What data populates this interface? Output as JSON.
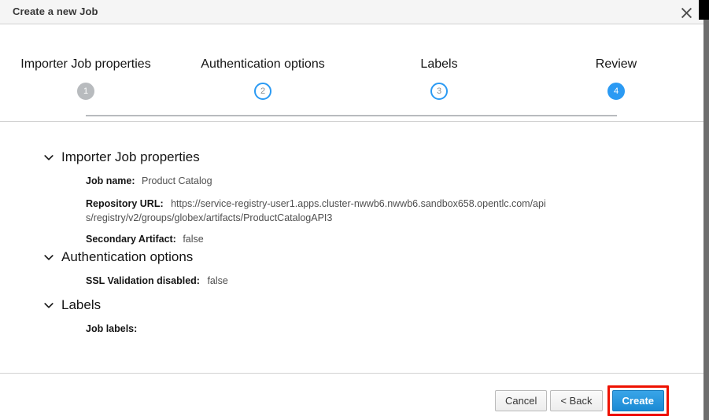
{
  "window": {
    "title": "Create a new Job",
    "close_icon": "close-icon"
  },
  "stepper": {
    "steps": [
      {
        "number": "1",
        "label": "Importer Job properties",
        "state": "done"
      },
      {
        "number": "2",
        "label": "Authentication options",
        "state": "pending"
      },
      {
        "number": "3",
        "label": "Labels",
        "state": "pending"
      },
      {
        "number": "4",
        "label": "Review",
        "state": "current"
      }
    ]
  },
  "review": {
    "sections": [
      {
        "title": "Importer Job properties",
        "chevron_icon": "chevron-down-icon",
        "expanded": true,
        "properties": [
          {
            "key": "Job name:",
            "value": "Product Catalog"
          },
          {
            "key": "Repository URL:",
            "value": "https://service-registry-user1.apps.cluster-nwwb6.nwwb6.sandbox658.opentlc.com/apis/registry/v2/groups/globex/artifacts/ProductCatalogAPI3"
          },
          {
            "key": "Secondary Artifact:",
            "value": "false"
          }
        ]
      },
      {
        "title": "Authentication options",
        "chevron_icon": "chevron-down-icon",
        "expanded": true,
        "properties": [
          {
            "key": "SSL Validation disabled:",
            "value": "false"
          }
        ]
      },
      {
        "title": "Labels",
        "chevron_icon": "chevron-down-icon",
        "expanded": true,
        "properties": [
          {
            "key": "Job labels:",
            "value": ""
          }
        ]
      }
    ]
  },
  "footer": {
    "cancel_label": "Cancel",
    "back_label": "< Back",
    "create_label": "Create"
  },
  "colors": {
    "accent_blue": "#2b9af3",
    "primary_button": "#1b8ad4",
    "step_done_gray": "#b8bbbe",
    "highlight_red": "#ee1100",
    "header_bg": "#f5f5f5",
    "divider": "#d2d2d2"
  }
}
